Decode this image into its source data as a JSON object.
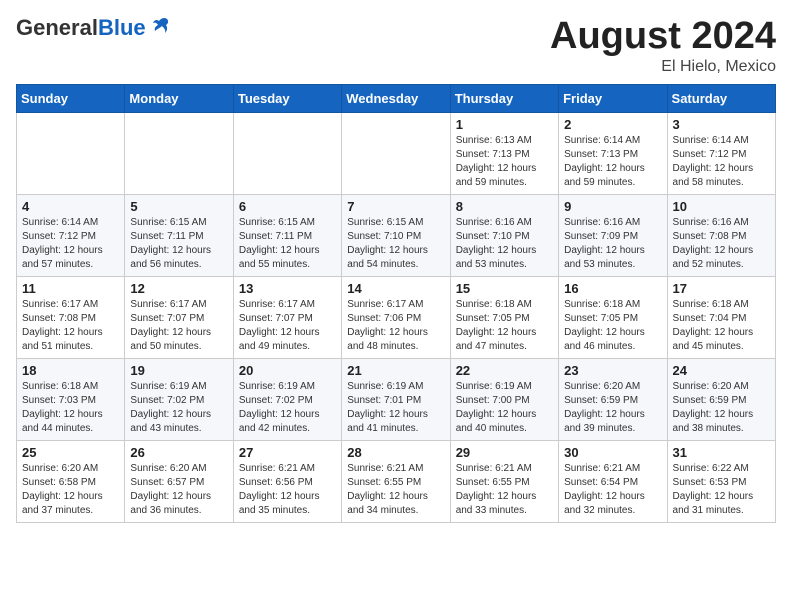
{
  "header": {
    "logo_general": "General",
    "logo_blue": "Blue",
    "month_title": "August 2024",
    "location": "El Hielo, Mexico"
  },
  "days_of_week": [
    "Sunday",
    "Monday",
    "Tuesday",
    "Wednesday",
    "Thursday",
    "Friday",
    "Saturday"
  ],
  "weeks": [
    [
      {
        "day": "",
        "info": ""
      },
      {
        "day": "",
        "info": ""
      },
      {
        "day": "",
        "info": ""
      },
      {
        "day": "",
        "info": ""
      },
      {
        "day": "1",
        "info": "Sunrise: 6:13 AM\nSunset: 7:13 PM\nDaylight: 12 hours\nand 59 minutes."
      },
      {
        "day": "2",
        "info": "Sunrise: 6:14 AM\nSunset: 7:13 PM\nDaylight: 12 hours\nand 59 minutes."
      },
      {
        "day": "3",
        "info": "Sunrise: 6:14 AM\nSunset: 7:12 PM\nDaylight: 12 hours\nand 58 minutes."
      }
    ],
    [
      {
        "day": "4",
        "info": "Sunrise: 6:14 AM\nSunset: 7:12 PM\nDaylight: 12 hours\nand 57 minutes."
      },
      {
        "day": "5",
        "info": "Sunrise: 6:15 AM\nSunset: 7:11 PM\nDaylight: 12 hours\nand 56 minutes."
      },
      {
        "day": "6",
        "info": "Sunrise: 6:15 AM\nSunset: 7:11 PM\nDaylight: 12 hours\nand 55 minutes."
      },
      {
        "day": "7",
        "info": "Sunrise: 6:15 AM\nSunset: 7:10 PM\nDaylight: 12 hours\nand 54 minutes."
      },
      {
        "day": "8",
        "info": "Sunrise: 6:16 AM\nSunset: 7:10 PM\nDaylight: 12 hours\nand 53 minutes."
      },
      {
        "day": "9",
        "info": "Sunrise: 6:16 AM\nSunset: 7:09 PM\nDaylight: 12 hours\nand 53 minutes."
      },
      {
        "day": "10",
        "info": "Sunrise: 6:16 AM\nSunset: 7:08 PM\nDaylight: 12 hours\nand 52 minutes."
      }
    ],
    [
      {
        "day": "11",
        "info": "Sunrise: 6:17 AM\nSunset: 7:08 PM\nDaylight: 12 hours\nand 51 minutes."
      },
      {
        "day": "12",
        "info": "Sunrise: 6:17 AM\nSunset: 7:07 PM\nDaylight: 12 hours\nand 50 minutes."
      },
      {
        "day": "13",
        "info": "Sunrise: 6:17 AM\nSunset: 7:07 PM\nDaylight: 12 hours\nand 49 minutes."
      },
      {
        "day": "14",
        "info": "Sunrise: 6:17 AM\nSunset: 7:06 PM\nDaylight: 12 hours\nand 48 minutes."
      },
      {
        "day": "15",
        "info": "Sunrise: 6:18 AM\nSunset: 7:05 PM\nDaylight: 12 hours\nand 47 minutes."
      },
      {
        "day": "16",
        "info": "Sunrise: 6:18 AM\nSunset: 7:05 PM\nDaylight: 12 hours\nand 46 minutes."
      },
      {
        "day": "17",
        "info": "Sunrise: 6:18 AM\nSunset: 7:04 PM\nDaylight: 12 hours\nand 45 minutes."
      }
    ],
    [
      {
        "day": "18",
        "info": "Sunrise: 6:18 AM\nSunset: 7:03 PM\nDaylight: 12 hours\nand 44 minutes."
      },
      {
        "day": "19",
        "info": "Sunrise: 6:19 AM\nSunset: 7:02 PM\nDaylight: 12 hours\nand 43 minutes."
      },
      {
        "day": "20",
        "info": "Sunrise: 6:19 AM\nSunset: 7:02 PM\nDaylight: 12 hours\nand 42 minutes."
      },
      {
        "day": "21",
        "info": "Sunrise: 6:19 AM\nSunset: 7:01 PM\nDaylight: 12 hours\nand 41 minutes."
      },
      {
        "day": "22",
        "info": "Sunrise: 6:19 AM\nSunset: 7:00 PM\nDaylight: 12 hours\nand 40 minutes."
      },
      {
        "day": "23",
        "info": "Sunrise: 6:20 AM\nSunset: 6:59 PM\nDaylight: 12 hours\nand 39 minutes."
      },
      {
        "day": "24",
        "info": "Sunrise: 6:20 AM\nSunset: 6:59 PM\nDaylight: 12 hours\nand 38 minutes."
      }
    ],
    [
      {
        "day": "25",
        "info": "Sunrise: 6:20 AM\nSunset: 6:58 PM\nDaylight: 12 hours\nand 37 minutes."
      },
      {
        "day": "26",
        "info": "Sunrise: 6:20 AM\nSunset: 6:57 PM\nDaylight: 12 hours\nand 36 minutes."
      },
      {
        "day": "27",
        "info": "Sunrise: 6:21 AM\nSunset: 6:56 PM\nDaylight: 12 hours\nand 35 minutes."
      },
      {
        "day": "28",
        "info": "Sunrise: 6:21 AM\nSunset: 6:55 PM\nDaylight: 12 hours\nand 34 minutes."
      },
      {
        "day": "29",
        "info": "Sunrise: 6:21 AM\nSunset: 6:55 PM\nDaylight: 12 hours\nand 33 minutes."
      },
      {
        "day": "30",
        "info": "Sunrise: 6:21 AM\nSunset: 6:54 PM\nDaylight: 12 hours\nand 32 minutes."
      },
      {
        "day": "31",
        "info": "Sunrise: 6:22 AM\nSunset: 6:53 PM\nDaylight: 12 hours\nand 31 minutes."
      }
    ]
  ]
}
